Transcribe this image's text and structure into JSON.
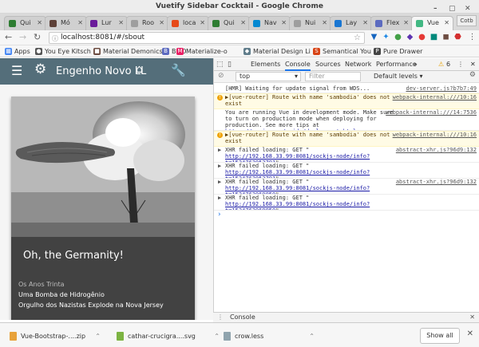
{
  "window": {
    "title": "Vuetify Sidebar Cocktail - Google Chrome",
    "controls": [
      "–",
      "▢",
      "✕"
    ]
  },
  "tabs": [
    {
      "label": "Qui",
      "color": "#2e7d32",
      "active": false
    },
    {
      "label": "Mó",
      "color": "#5d4037",
      "active": false
    },
    {
      "label": "Lur",
      "color": "#6a1b9a",
      "active": false
    },
    {
      "label": "Roo",
      "color": "#9e9e9e",
      "active": false
    },
    {
      "label": "loca",
      "color": "#e64a19",
      "active": false
    },
    {
      "label": "Qui",
      "color": "#2e7d32",
      "active": false
    },
    {
      "label": "Nav",
      "color": "#0288d1",
      "active": false
    },
    {
      "label": "Nui",
      "color": "#9e9e9e",
      "active": false
    },
    {
      "label": "Lay",
      "color": "#1976d2",
      "active": false
    },
    {
      "label": "Flex",
      "color": "#5c6bc0",
      "active": false
    },
    {
      "label": "Vue",
      "color": "#42b883",
      "active": true
    }
  ],
  "profile_label": "Cotb",
  "address": {
    "url": "localhost:8081/#/sbout"
  },
  "bookmarks": [
    {
      "label": "Apps",
      "color": "#4285f4",
      "glyph": "▦"
    },
    {
      "label": "You Eye Kitsch",
      "color": "#555",
      "glyph": "●"
    },
    {
      "label": "Material Demonics",
      "color": "#6d4c41",
      "glyph": "■"
    },
    {
      "label": "BMD",
      "color": "#5c6bc0",
      "glyph": "B"
    },
    {
      "label": "Materialize-o",
      "color": "#e91e63",
      "glyph": "M"
    },
    {
      "label": "Material Design Li",
      "color": "#607d8b",
      "glyph": "◆"
    },
    {
      "label": "Semantical You",
      "color": "#d84315",
      "glyph": "S"
    },
    {
      "label": "Pure Drawer",
      "color": "#444",
      "glyph": "P"
    }
  ],
  "app": {
    "title": "Engenho Novo LL",
    "card": {
      "headline": "Oh, the Germanity!",
      "subtitle": "Os Anos Trinta",
      "line1": "Uma Bomba de Hidrogênio",
      "line2": "Orgulho dos Nazistas Explode na Nova Jersey"
    }
  },
  "devtools": {
    "tabs": [
      "Elements",
      "Console",
      "Sources",
      "Network",
      "Performance"
    ],
    "active_tab": "Console",
    "warning_count": "6",
    "context": "top",
    "filter_placeholder": "Filter",
    "levels": "Default levels ▾",
    "messages": [
      {
        "kind": "log",
        "text": "[HMR] Waiting for update signal from WDS...",
        "source": "dev-server.js?b7b7:49"
      },
      {
        "kind": "warn",
        "text": "▶[vue-router] Route with name 'sambodia' does not exist",
        "source": "webpack-internal:///10:16"
      },
      {
        "kind": "log",
        "text": "You are running Vue in development mode. Make sure to turn on production mode when deploying for production. See more tips at",
        "link": "https://vuejs.org/guide/deployment.html",
        "source": "webpack-internal:///14:7536"
      },
      {
        "kind": "warn",
        "text": "▶[vue-router] Route with name 'sambodia' does not exist",
        "source": "webpack-internal:///10:16"
      },
      {
        "kind": "xhr",
        "text": "XHR failed loading: GET \"",
        "link": "http://192.168.33.99:8081/sockjs-node/info?t=1524763053791",
        "tail": "\".",
        "source": "abstract-xhr.js?96d9:132"
      },
      {
        "kind": "xhr",
        "text": "XHR failed loading: GET \"",
        "link": "http://192.168.33.99:8081/sockjs-node/info?t=1524763053791",
        "tail": "\".",
        "source": ""
      },
      {
        "kind": "xhr",
        "text": "XHR failed loading: GET \"",
        "link": "http://192.168.33.99:8081/sockjs-node/info?t=1524763069850",
        "tail": "\".",
        "source": "abstract-xhr.js?96d9:132"
      },
      {
        "kind": "xhr",
        "text": "XHR failed loading: GET \"",
        "link": "http://192.168.33.99:8081/sockjs-node/info?t=1524763069850",
        "tail": "\".",
        "source": ""
      }
    ],
    "drawer_label": "Console"
  },
  "downloads": {
    "items": [
      "Vue-Bootstrap-....zip",
      "cathar-crucigra....svg",
      "crow.less"
    ],
    "show_all": "Show all"
  }
}
